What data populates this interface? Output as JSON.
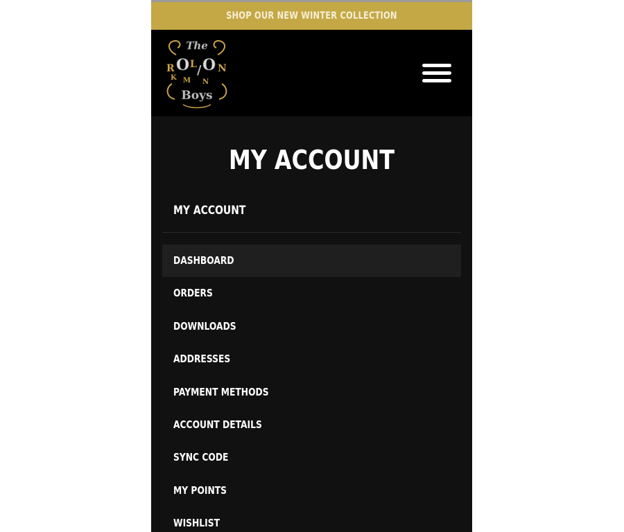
{
  "promo": {
    "text": "SHOP OUR NEW WINTER COLLECTION"
  },
  "header": {
    "logo_icon": "the-rollin-boys-logo",
    "menu_icon": "hamburger-menu-icon"
  },
  "page": {
    "title": "MY ACCOUNT"
  },
  "account_nav": {
    "heading": "MY ACCOUNT",
    "items": [
      {
        "label": "DASHBOARD",
        "active": true
      },
      {
        "label": "ORDERS",
        "active": false
      },
      {
        "label": "DOWNLOADS",
        "active": false
      },
      {
        "label": "ADDRESSES",
        "active": false
      },
      {
        "label": "PAYMENT METHODS",
        "active": false
      },
      {
        "label": "ACCOUNT DETAILS",
        "active": false
      },
      {
        "label": "SYNC CODE",
        "active": false
      },
      {
        "label": "MY POINTS",
        "active": false
      },
      {
        "label": "WISHLIST",
        "active": false
      }
    ]
  },
  "colors": {
    "promo_bg": "#c4a845",
    "header_bg": "#000000",
    "page_bg": "#111111",
    "active_item_bg": "#1f1f1f",
    "logo_gold": "#c9a24a"
  }
}
